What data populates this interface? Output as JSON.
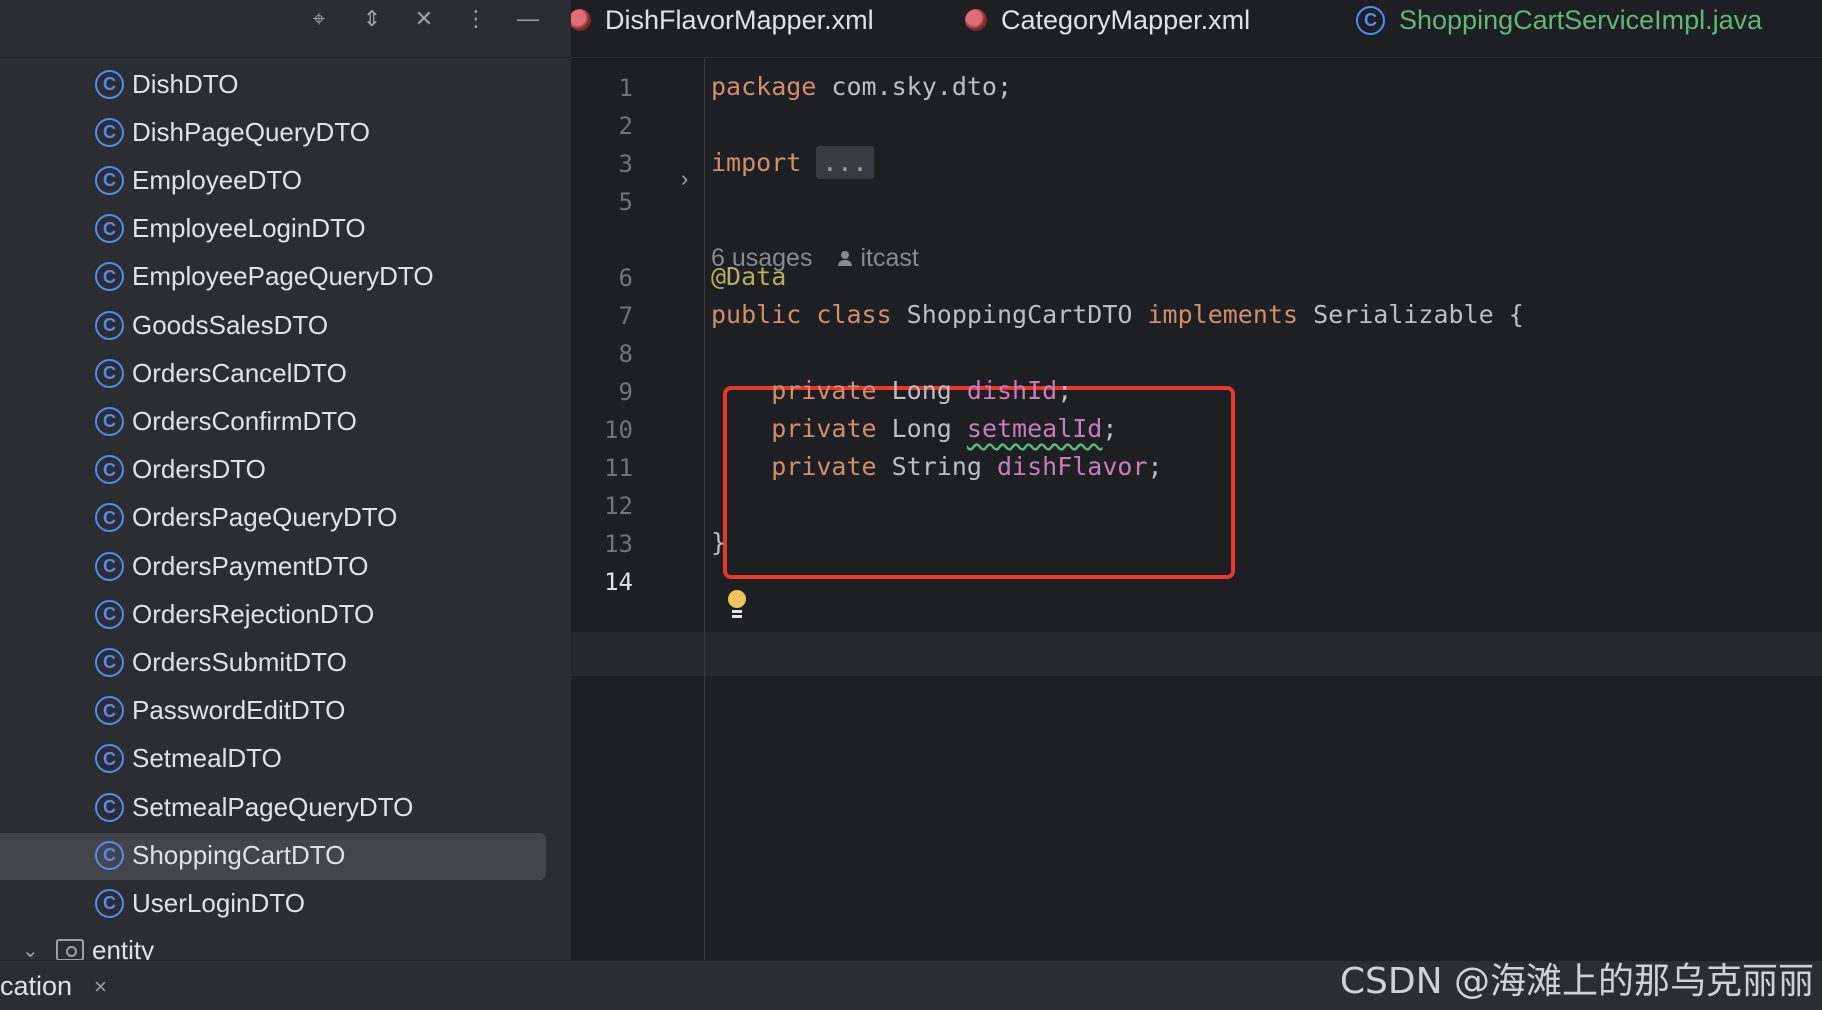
{
  "toolbar": {
    "icons": [
      "crosshair-icon",
      "expand-collapse-icon",
      "collapse-all-icon",
      "more-icon",
      "minimize-icon"
    ],
    "glyphs": [
      "⌖",
      "⇕",
      "✕",
      "⋮",
      "—"
    ]
  },
  "tree": {
    "class_icon_letter": "C",
    "items": [
      {
        "label": "DishDTO"
      },
      {
        "label": "DishPageQueryDTO"
      },
      {
        "label": "EmployeeDTO"
      },
      {
        "label": "EmployeeLoginDTO"
      },
      {
        "label": "EmployeePageQueryDTO"
      },
      {
        "label": "GoodsSalesDTO"
      },
      {
        "label": "OrdersCancelDTO"
      },
      {
        "label": "OrdersConfirmDTO"
      },
      {
        "label": "OrdersDTO"
      },
      {
        "label": "OrdersPageQueryDTO"
      },
      {
        "label": "OrdersPaymentDTO"
      },
      {
        "label": "OrdersRejectionDTO"
      },
      {
        "label": "OrdersSubmitDTO"
      },
      {
        "label": "PasswordEditDTO"
      },
      {
        "label": "SetmealDTO"
      },
      {
        "label": "SetmealPageQueryDTO"
      },
      {
        "label": "ShoppingCartDTO",
        "selected": true
      },
      {
        "label": "UserLoginDTO"
      }
    ],
    "folder": {
      "label": "entity",
      "chevron": "⌄"
    }
  },
  "tabs": [
    {
      "label": "DishFlavorMapper.xml",
      "icon": "xml-mapper-icon",
      "color": "#dfe1e5"
    },
    {
      "label": "CategoryMapper.xml",
      "icon": "xml-mapper-icon",
      "color": "#dfe1e5"
    },
    {
      "label": "ShoppingCartServiceImpl.java",
      "icon": "java-class-icon",
      "color": "#5fb878"
    }
  ],
  "editor": {
    "lines": [
      {
        "num": "1",
        "tokens": [
          {
            "t": "package ",
            "c": "kw"
          },
          {
            "t": "com.sky.dto;",
            "c": "plain"
          }
        ]
      },
      {
        "num": "2",
        "tokens": []
      },
      {
        "num": "3",
        "tokens": [
          {
            "t": "import ",
            "c": "kw"
          },
          {
            "t": "...",
            "c": "folded"
          }
        ]
      },
      {
        "num": "5",
        "tokens": []
      },
      {
        "num": "6",
        "tokens": [
          {
            "t": "@Data",
            "c": "ann"
          }
        ]
      },
      {
        "num": "7",
        "tokens": [
          {
            "t": "public class ",
            "c": "kw"
          },
          {
            "t": "ShoppingCartDTO ",
            "c": "plain"
          },
          {
            "t": "implements ",
            "c": "kw"
          },
          {
            "t": "Serializable {",
            "c": "plain"
          }
        ]
      },
      {
        "num": "8",
        "tokens": []
      },
      {
        "num": "9",
        "tokens": [
          {
            "t": "    private ",
            "c": "kw"
          },
          {
            "t": "Long ",
            "c": "plain"
          },
          {
            "t": "dishId",
            "c": "field"
          },
          {
            "t": ";",
            "c": "plain"
          }
        ]
      },
      {
        "num": "10",
        "tokens": [
          {
            "t": "    private ",
            "c": "kw"
          },
          {
            "t": "Long ",
            "c": "plain"
          },
          {
            "t": "setmealId",
            "c": "field squiggle"
          },
          {
            "t": ";",
            "c": "plain"
          }
        ]
      },
      {
        "num": "11",
        "tokens": [
          {
            "t": "    private ",
            "c": "kw"
          },
          {
            "t": "String ",
            "c": "plain"
          },
          {
            "t": "dishFlavor",
            "c": "field"
          },
          {
            "t": ";",
            "c": "plain"
          }
        ]
      },
      {
        "num": "12",
        "tokens": []
      },
      {
        "num": "13",
        "tokens": [
          {
            "t": "}",
            "c": "plain"
          }
        ]
      },
      {
        "num": "14",
        "tokens": [],
        "active": true
      }
    ],
    "usages": "6 usages",
    "author": "itcast",
    "fold_arrow": "›"
  },
  "bottom": {
    "tab_label": "cation",
    "close": "×"
  },
  "watermark": "CSDN @海滩上的那乌克丽丽"
}
